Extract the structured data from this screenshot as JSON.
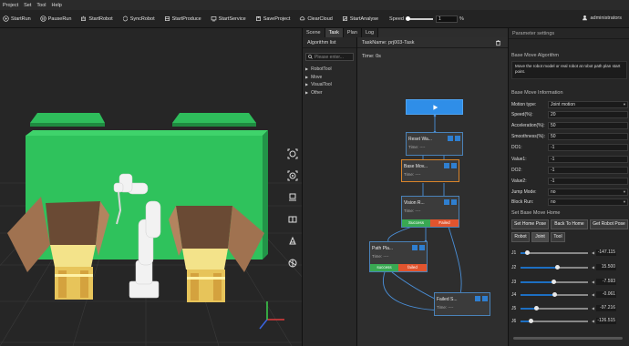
{
  "menu": [
    "Project",
    "Set",
    "Tool",
    "Help"
  ],
  "toolbar": {
    "buttons": [
      "StartRun",
      "PauseRun",
      "StartRobot",
      "SyncRobot",
      "StartProduce",
      "StartService",
      "SaveProject",
      "ClearCloud",
      "StartAnalyse"
    ],
    "speed_label": "Speed",
    "speed_value": "1",
    "speed_unit": "%",
    "speed_level_percent": 1,
    "user": "administrators"
  },
  "tabs": [
    "Scene",
    "Task",
    "Plan",
    "Log"
  ],
  "active_tab": "Task",
  "algorithm": {
    "title": "Algorithm list",
    "search_placeholder": "Please enter...",
    "items": [
      "RobotTool",
      "Move",
      "VisualTool",
      "Other"
    ]
  },
  "task": {
    "name": "TaskName: prj003-Task",
    "time": "Time: 0s",
    "nodes": [
      {
        "title": "Reset Wa...",
        "time": "Time: ----"
      },
      {
        "title": "Base Mov...",
        "time": "Time: ----"
      },
      {
        "title": "Vision R...",
        "time": "Time: ----",
        "success": "Success",
        "failed": "Failed"
      },
      {
        "title": "Path Pla...",
        "time": "Time: ----",
        "success": "success",
        "failed": "failed"
      },
      {
        "title": "Failed S...",
        "time": "Time: ----"
      }
    ]
  },
  "params": {
    "title": "Parameter settings",
    "algorithm_section": "Base Move Algorithm",
    "description": "Move the robot model or real robot at robot path plan start point.",
    "info_section": "Base Move Information",
    "fields": [
      {
        "label": "Motion type:",
        "value": "Joint motion",
        "dropdown": true
      },
      {
        "label": "Speed(%):",
        "value": "20"
      },
      {
        "label": "Acceleration(%):",
        "value": "50"
      },
      {
        "label": "Smoothness(%):",
        "value": "50"
      },
      {
        "label": "DO1:",
        "value": "-1"
      },
      {
        "label": "Value1:",
        "value": "-1"
      },
      {
        "label": "DO2:",
        "value": "-1"
      },
      {
        "label": "Value2:",
        "value": "-1"
      },
      {
        "label": "Jump Mode:",
        "value": "no",
        "dropdown": true
      },
      {
        "label": "Block Run:",
        "value": "no",
        "dropdown": true
      }
    ],
    "home_section": "Set Base Move Home",
    "home_buttons": [
      "Set Home Pose",
      "Back To Home",
      "Get Robot Pose"
    ],
    "mode_buttons": [
      "Robot",
      "Joint",
      "Tool"
    ],
    "joints": [
      {
        "label": "J1",
        "value": "-147.115",
        "pos": 0.1
      },
      {
        "label": "J2",
        "value": "15.500",
        "pos": 0.54
      },
      {
        "label": "J3",
        "value": "-7.593",
        "pos": 0.48
      },
      {
        "label": "J4",
        "value": "-0.061",
        "pos": 0.5
      },
      {
        "label": "J5",
        "value": "-97.216",
        "pos": 0.23
      },
      {
        "label": "J6",
        "value": "-126.515",
        "pos": 0.15
      }
    ]
  }
}
